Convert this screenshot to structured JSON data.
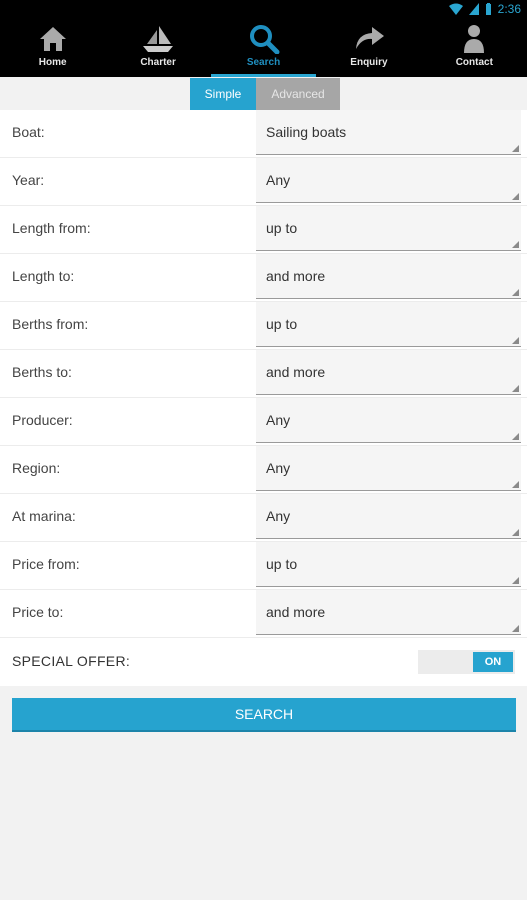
{
  "status_bar": {
    "time": "2:36"
  },
  "nav": {
    "items": [
      {
        "label": "Home",
        "icon": "home-icon"
      },
      {
        "label": "Charter",
        "icon": "sailboat-icon"
      },
      {
        "label": "Search",
        "icon": "search-icon",
        "active": true
      },
      {
        "label": "Enquiry",
        "icon": "share-arrow-icon"
      },
      {
        "label": "Contact",
        "icon": "person-icon"
      }
    ]
  },
  "tabs": {
    "simple": "Simple",
    "advanced": "Advanced"
  },
  "form": {
    "rows": [
      {
        "label": "Boat:",
        "value": "Sailing boats"
      },
      {
        "label": "Year:",
        "value": "Any"
      },
      {
        "label": "Length from:",
        "value": "up to"
      },
      {
        "label": "Length to:",
        "value": "and more"
      },
      {
        "label": "Berths from:",
        "value": "up to"
      },
      {
        "label": "Berths to:",
        "value": "and more"
      },
      {
        "label": "Producer:",
        "value": "Any"
      },
      {
        "label": "Region:",
        "value": "Any"
      },
      {
        "label": "At marina:",
        "value": "Any"
      },
      {
        "label": "Price from:",
        "value": "up to"
      },
      {
        "label": "Price to:",
        "value": "and more"
      }
    ],
    "special_offer": {
      "label": "SPECIAL OFFER:",
      "toggle": "ON"
    }
  },
  "search_button": "SEARCH",
  "colors": {
    "accent": "#26a3cf",
    "nav_bg": "#000000",
    "tab_inactive": "#a6a6a6"
  }
}
